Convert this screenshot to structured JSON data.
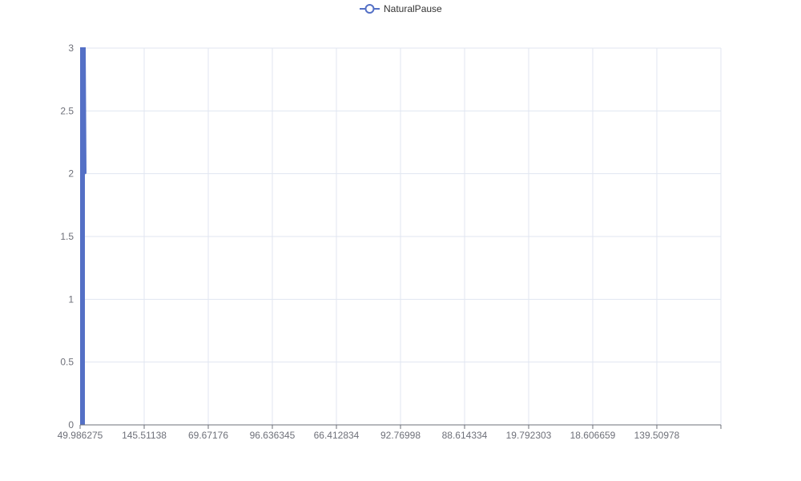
{
  "chart_data": {
    "type": "line",
    "x": [
      "49.986275",
      "145.51138",
      "69.67176",
      "96.636345",
      "66.412834",
      "92.76998",
      "88.614334",
      "19.792303",
      "18.606659",
      "139.50978"
    ],
    "series": [
      {
        "name": "NaturalPause",
        "values": [
          3,
          2
        ]
      }
    ],
    "ylim": [
      0,
      3
    ],
    "yticks": [
      "0",
      "0.5",
      "1",
      "1.5",
      "2",
      "2.5",
      "3"
    ],
    "legend": "top-center",
    "grid": true,
    "colors": {
      "series": "#5470c6",
      "grid": "#e0e6f1",
      "axis": "#6e7079",
      "text": "#6e7079",
      "legend_text": "#333333"
    }
  }
}
